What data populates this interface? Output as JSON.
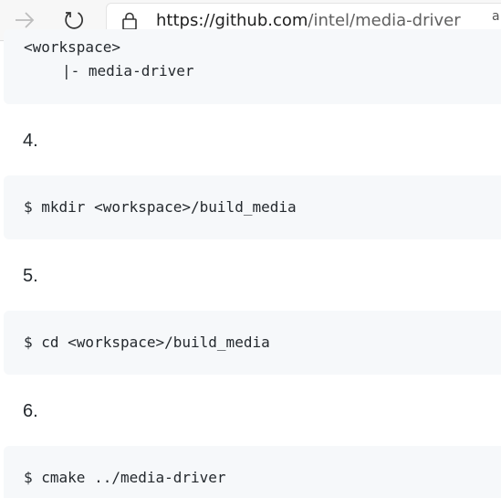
{
  "browser": {
    "url_host": "https://github.com",
    "url_path": "/intel/media-driver",
    "extension_fragment": "a"
  },
  "content": {
    "tree": {
      "root": "<workspace>",
      "child": "|- media-driver"
    },
    "steps": [
      {
        "number": "4.",
        "command": "$ mkdir <workspace>/build_media"
      },
      {
        "number": "5.",
        "command": "$ cd <workspace>/build_media"
      },
      {
        "number": "6.",
        "command": "$ cmake ../media-driver"
      }
    ]
  }
}
